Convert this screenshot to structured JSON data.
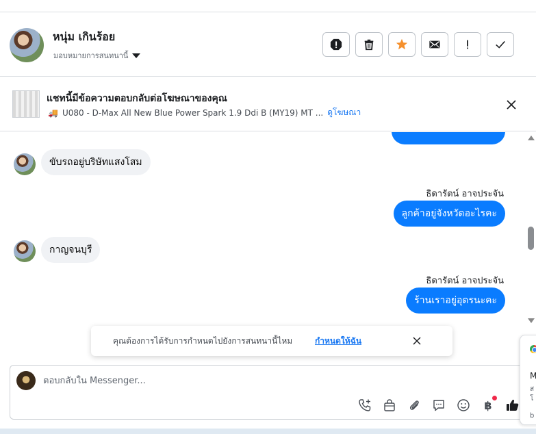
{
  "header": {
    "contact_name": "หนุ่ม เกินร้อย",
    "assign_label": "มอบหมายการสนทนานี้",
    "actions": [
      {
        "name": "spam-report-button",
        "icon": "alert-octagon-icon",
        "color": "#1c1e21"
      },
      {
        "name": "delete-button",
        "icon": "trash-icon",
        "color": "#1c1e21"
      },
      {
        "name": "star-button",
        "icon": "star-icon",
        "color": "#f5902d"
      },
      {
        "name": "mark-unread-button",
        "icon": "envelope-icon",
        "color": "#1c1e21"
      },
      {
        "name": "follow-up-button",
        "icon": "exclamation-icon",
        "color": "#1c1e21"
      },
      {
        "name": "mark-done-button",
        "icon": "check-icon",
        "color": "#1c1e21"
      }
    ]
  },
  "ad_banner": {
    "title": "แชทนี้มีข้อความตอบกลับต่อโฆษณาของคุณ",
    "product": "U080 - D-Max All New Blue Power Spark 1.9 Ddi B (MY19) MT ...",
    "link": "ดูโฆษณา"
  },
  "messages": [
    {
      "side": "in",
      "text": "ขับรถอยู่บริษัทแสงโสม"
    },
    {
      "side": "out",
      "sender": "ธิดารัตน์ อาจประจัน",
      "text": "ลูกค้าอยู่จังหวัดอะไรคะ"
    },
    {
      "side": "in",
      "text": "กาญจนบุรี"
    },
    {
      "side": "out",
      "sender": "ธิดารัตน์ อาจประจัน",
      "text": "ร้านเราอยู่อุดรนะคะ"
    }
  ],
  "toast": {
    "text": "คุณต้องการได้รับการกำหนดไปยังการสนทนานี้ไหม",
    "link": "กำหนดให้ฉัน"
  },
  "composer": {
    "placeholder": "ตอบกลับใน Messenger...",
    "baht_symbol": "฿",
    "tools": [
      "phone-add-icon",
      "shopping-bag-icon",
      "paperclip-icon",
      "saved-reply-icon",
      "emoji-icon",
      "baht-icon",
      "thumbs-up-icon"
    ]
  },
  "side_card": {
    "t1": "M",
    "t2a": "ส",
    "t2b": "โ",
    "t3": "b"
  },
  "colors": {
    "accent": "#0a7cff",
    "link": "#1877f2",
    "star": "#f5902d",
    "notification": "#f02849"
  }
}
